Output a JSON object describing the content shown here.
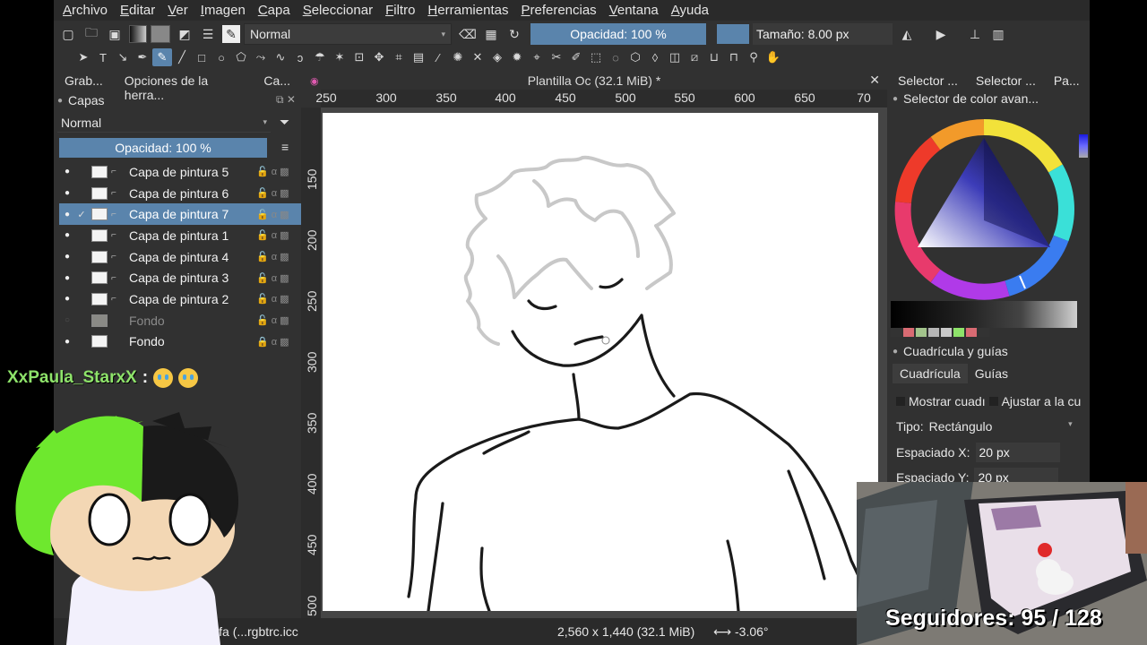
{
  "menu": [
    "Archivo",
    "Editar",
    "Ver",
    "Imagen",
    "Capa",
    "Seleccionar",
    "Filtro",
    "Herramientas",
    "Preferencias",
    "Ventana",
    "Ayuda"
  ],
  "toolbar": {
    "blend_mode": "Normal",
    "opacity": "Opacidad: 100 %",
    "size": "Tamaño: 8.00 px"
  },
  "left_dock": {
    "tabs": [
      "Grab...",
      "Opciones de la herra...",
      "Ca..."
    ],
    "panel_title": "Capas",
    "blend_mode": "Normal",
    "opacity": "Opacidad:  100 %",
    "layers": [
      {
        "name": "Capa de pintura 5",
        "visible": true,
        "selected": false
      },
      {
        "name": "Capa de pintura 6",
        "visible": true,
        "selected": false
      },
      {
        "name": "Capa de pintura 7",
        "visible": true,
        "selected": true
      },
      {
        "name": "Capa de pintura 1",
        "visible": true,
        "selected": false
      },
      {
        "name": "Capa de pintura 4",
        "visible": true,
        "selected": false
      },
      {
        "name": "Capa de pintura 3",
        "visible": true,
        "selected": false
      },
      {
        "name": "Capa de pintura 2",
        "visible": true,
        "selected": false
      },
      {
        "name": "Fondo",
        "visible": false,
        "selected": false
      },
      {
        "name": "Fondo",
        "visible": true,
        "selected": false
      }
    ]
  },
  "canvas": {
    "doc_title": "Plantilla Oc (32.1 MiB) *",
    "ruler_h": [
      "250",
      "300",
      "350",
      "400",
      "450",
      "500",
      "550",
      "600",
      "650",
      "70"
    ],
    "ruler_v": [
      "150",
      "200",
      "250",
      "300",
      "350",
      "400",
      "450",
      "500"
    ]
  },
  "right_dock": {
    "tabs": [
      "Selector ...",
      "Selector ...",
      "Pa..."
    ],
    "color_title": "Selector de color avan...",
    "grid_title": "Cuadrícula y guías",
    "grid_tabs": [
      "Cuadrícula",
      "Guías"
    ],
    "show_grid": "Mostrar cuadı",
    "snap_grid": "Ajustar a la cu",
    "type_label": "Tipo:",
    "type_value": "Rectángulo",
    "spacing_x_label": "Espaciado X:",
    "spacing_x": "20 px",
    "spacing_y_label": "Espaciado Y:",
    "spacing_y": "20 px"
  },
  "status": {
    "profile": "B/alfa (...rgbtrc.icc",
    "dimensions": "2,560 x 1,440 (32.1 MiB)",
    "rotation": "-3.06°"
  },
  "stream": {
    "chat_user": "XxPaula_StarxX",
    "chat_sep": ":",
    "followers": "Seguidores: 95 / 128"
  }
}
